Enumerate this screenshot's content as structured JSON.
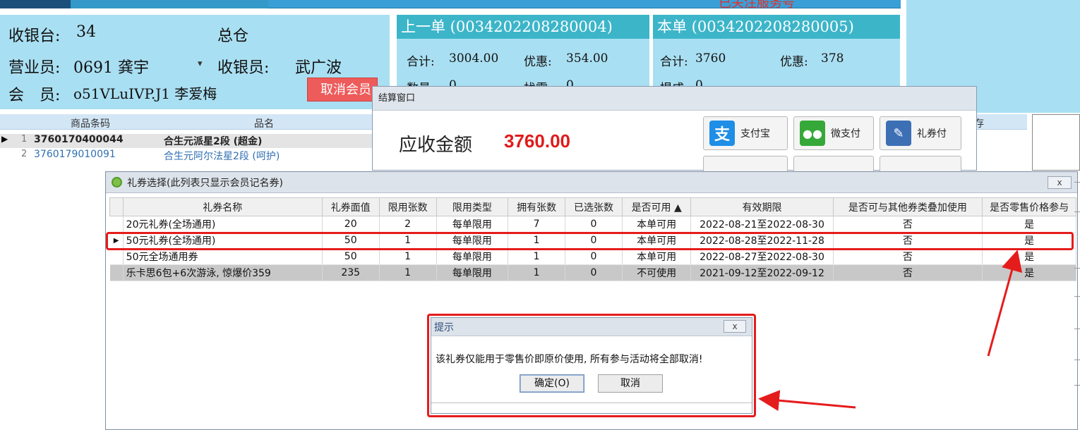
{
  "top_bar": {
    "right_text": "已关注服务号"
  },
  "cashier_info": {
    "register_label": "收银台:",
    "register_value": "34",
    "warehouse": "总仓",
    "salesperson_label": "营业员:",
    "salesperson_value": "0691 龚宇",
    "cashier_label": "收银员:",
    "cashier_value": "武广波",
    "member_label": "会　员:",
    "member_value": "o51VLuIVP.J1 李爱梅",
    "cancel_member_label": "取消会员"
  },
  "previous_order": {
    "title": "上一单 (0034202208280004)",
    "total_label": "合计:",
    "total_value": "3004.00",
    "discount_label": "优惠:",
    "discount_value": "354.00",
    "qty_label": "数量:",
    "qty_value": "0",
    "change_label": "找零:",
    "change_value": "0"
  },
  "current_order": {
    "title": "本单 (0034202208280005)",
    "total_label": "合计:",
    "total_value": "3760",
    "discount_label": "优惠:",
    "discount_value": "378",
    "commission_label": "提成:",
    "commission_value": "0"
  },
  "product_grid": {
    "headers": {
      "barcode": "商品条码",
      "name": "品名",
      "stock": "存"
    },
    "rows": [
      {
        "no": "1",
        "barcode": "3760170400044",
        "name": "合生元派星2段 (超金)"
      },
      {
        "no": "2",
        "barcode": "3760179010091",
        "name": "合生元阿尔法星2段 (呵护)"
      }
    ]
  },
  "settlement": {
    "title": "结算窗口",
    "amount_label": "应收金额",
    "amount_value": "3760.00",
    "pay_buttons": [
      {
        "label": "支付宝",
        "icon": "alipay-icon"
      },
      {
        "label": "微支付",
        "icon": "wechat-icon"
      },
      {
        "label": "礼券付",
        "icon": "coupon-icon"
      }
    ]
  },
  "coupon_dialog": {
    "title": "礼券选择(此列表只显示会员记名券)",
    "close_label": "x",
    "columns": [
      "礼券名称",
      "礼券面值",
      "限用张数",
      "限用类型",
      "拥有张数",
      "已选张数",
      "是否可用 ▲",
      "有效期限",
      "是否可与其他券类叠加使用",
      "是否零售价格参与"
    ],
    "rows": [
      {
        "name": "20元礼券(全场通用)",
        "value": "20",
        "limit": "2",
        "limit_type": "每单限用",
        "owned": "7",
        "selected": "0",
        "usable": "本单可用",
        "validity": "2022-08-21至2022-08-30",
        "stackable": "否",
        "retail": "是"
      },
      {
        "name": "50元礼券(全场通用)",
        "value": "50",
        "limit": "1",
        "limit_type": "每单限用",
        "owned": "1",
        "selected": "0",
        "usable": "本单可用",
        "validity": "2022-08-28至2022-11-28",
        "stackable": "否",
        "retail": "是"
      },
      {
        "name": "50元全场通用券",
        "value": "50",
        "limit": "1",
        "limit_type": "每单限用",
        "owned": "1",
        "selected": "0",
        "usable": "本单可用",
        "validity": "2022-08-27至2022-08-30",
        "stackable": "否",
        "retail": "是"
      },
      {
        "name": "乐卡思6包+6次游泳, 惊爆价359",
        "value": "235",
        "limit": "1",
        "limit_type": "每单限用",
        "owned": "1",
        "selected": "0",
        "usable": "不可使用",
        "validity": "2021-09-12至2022-09-12",
        "stackable": "否",
        "retail": "是"
      }
    ]
  },
  "alert": {
    "title": "提示",
    "close_label": "x",
    "message": "该礼券仅能用于零售价即原价使用, 所有参与活动将全部取消!",
    "ok_label": "确定(O)",
    "cancel_label": "取消"
  },
  "colors": {
    "panel_bg": "#a9dff2",
    "order_header": "#3cb5c9",
    "highlight_red": "#e51c1c",
    "amount_red": "#e01b1b",
    "cancel_btn": "#ee5b5b"
  }
}
